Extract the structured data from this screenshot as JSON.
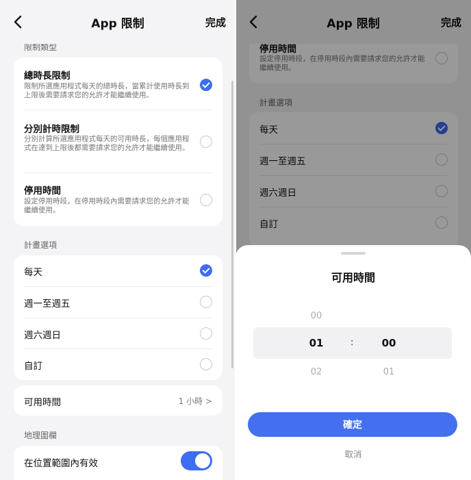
{
  "nav": {
    "title": "App 限制",
    "done": "完成"
  },
  "left": {
    "limit_type_label": "限制類型",
    "limit_types": [
      {
        "title": "總時長限制",
        "desc": "限制所選應用程式每天的總時長，當累計使用時長到上限後需要請求您的允許才能繼續使用。",
        "selected": true
      },
      {
        "title": "分別計時限制",
        "desc": "分別計算所選應用程式每天的可用時長，每個應用程式在達到上限後都需要請求您的允許才能繼續使用。",
        "selected": false
      },
      {
        "title": "停用時間",
        "desc": "設定停用時段，在停用時段內需要請求您的允許才能繼續使用。",
        "selected": false
      }
    ],
    "schedule_label": "計畫選項",
    "schedule_options": [
      {
        "label": "每天",
        "selected": true
      },
      {
        "label": "週一至週五",
        "selected": false
      },
      {
        "label": "週六週日",
        "selected": false
      },
      {
        "label": "自訂",
        "selected": false
      }
    ],
    "available_time": {
      "label": "可用時間",
      "value": "1 小時 >"
    },
    "geofence_label": "地理圍欄",
    "geofence_toggle": {
      "label": "在位置範圍內有效",
      "on": true
    }
  },
  "right": {
    "top_item": {
      "title": "停用時間",
      "desc": "設定停用時段，在停用時段內需要請求您的允許才能繼續使用。"
    },
    "schedule_label": "計畫選項",
    "schedule_options": [
      {
        "label": "每天",
        "selected": true
      },
      {
        "label": "週一至週五",
        "selected": false
      },
      {
        "label": "週六週日",
        "selected": false
      },
      {
        "label": "自訂",
        "selected": false
      }
    ],
    "sheet": {
      "title": "可用時間",
      "hours": {
        "prev": "00",
        "current": "01",
        "next": "02"
      },
      "minutes": {
        "current": "00",
        "next": "01"
      },
      "separator": ":",
      "confirm": "確定",
      "cancel": "取消"
    }
  },
  "colors": {
    "accent": "#3d6df2",
    "background": "#f4f4f6",
    "card": "#ffffff"
  }
}
